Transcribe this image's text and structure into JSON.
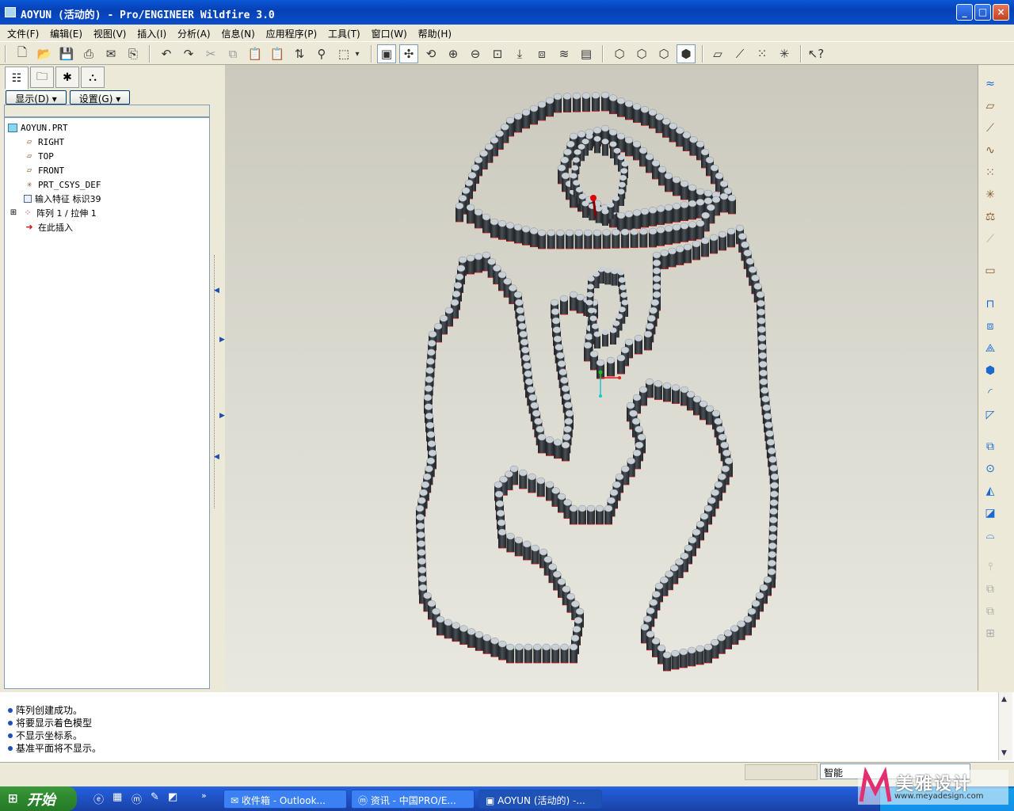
{
  "window": {
    "title": "AOYUN (活动的) - Pro/ENGINEER Wildfire 3.0",
    "minimize_label": "_",
    "maximize_label": "□",
    "close_label": "×"
  },
  "menu": [
    {
      "label": "文件(F)"
    },
    {
      "label": "编辑(E)"
    },
    {
      "label": "视图(V)"
    },
    {
      "label": "插入(I)"
    },
    {
      "label": "分析(A)"
    },
    {
      "label": "信息(N)"
    },
    {
      "label": "应用程序(P)"
    },
    {
      "label": "工具(T)"
    },
    {
      "label": "窗口(W)"
    },
    {
      "label": "帮助(H)"
    }
  ],
  "panel": {
    "show_label": "显示(D)",
    "settings_label": "设置(G)"
  },
  "tree": {
    "items": [
      {
        "label": "AOYUN.PRT",
        "icon": "part-icon"
      },
      {
        "label": "RIGHT",
        "icon": "datum-plane-icon"
      },
      {
        "label": "TOP",
        "icon": "datum-plane-icon"
      },
      {
        "label": "FRONT",
        "icon": "datum-plane-icon"
      },
      {
        "label": "PRT_CSYS_DEF",
        "icon": "coordinate-system-icon"
      },
      {
        "label": "输入特征 标识39",
        "icon": "import-feature-icon"
      },
      {
        "label": "阵列 1 / 拉伸 1",
        "icon": "pattern-icon"
      },
      {
        "label": "在此插入",
        "icon": "insert-here-arrow-icon"
      }
    ]
  },
  "messages": [
    "阵列创建成功。",
    "将要显示着色模型",
    "不显示坐标系。",
    "基准平面将不显示。"
  ],
  "status": {
    "filter_value": "智能"
  },
  "taskbar": {
    "start_label": "开始",
    "tasks": [
      {
        "label": "收件箱 - Outlook..."
      },
      {
        "label": "资讯 - 中国PRO/E..."
      },
      {
        "label": "AOYUN (活动的) -..."
      }
    ],
    "overflow_label": "»"
  },
  "watermark": {
    "brand": "美雅设计",
    "url": "www.meyadesign.com"
  },
  "colors": {
    "viewport_top": "#cbc9bd",
    "viewport_bottom": "#e9e8e0",
    "pin_body": "#2e3236",
    "pin_top": "#c9d1d6",
    "edge_red": "#d01010"
  }
}
